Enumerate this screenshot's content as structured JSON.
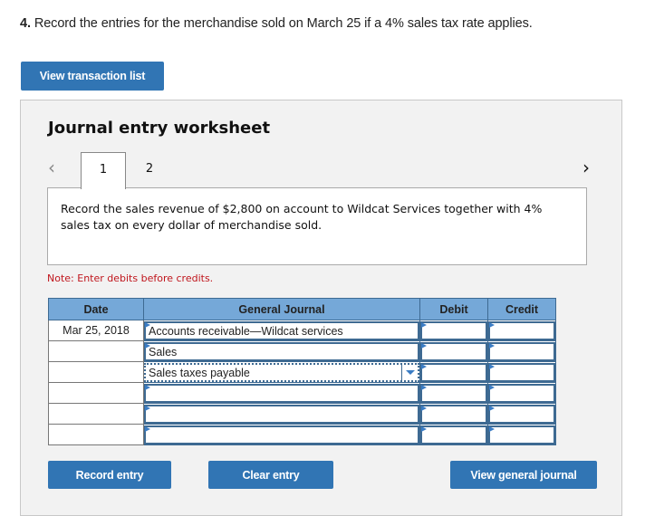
{
  "question": {
    "number": "4.",
    "text": " Record the entries for the merchandise sold on March 25 if a 4% sales tax rate applies."
  },
  "buttons": {
    "view_transaction_list": "View transaction list",
    "record_entry": "Record entry",
    "clear_entry": "Clear entry",
    "view_general_journal": "View general journal"
  },
  "worksheet": {
    "title": "Journal entry worksheet",
    "prev_icon": "‹",
    "next_icon": "›",
    "tabs": [
      {
        "label": "1",
        "active": true
      },
      {
        "label": "2",
        "active": false
      }
    ],
    "description": "Record the sales revenue of $2,800 on account to Wildcat Services together with 4% sales tax on every dollar of merchandise sold.",
    "note": "Note: Enter debits before credits."
  },
  "journal": {
    "headers": [
      "Date",
      "General Journal",
      "Debit",
      "Credit"
    ],
    "rows": [
      {
        "date": "Mar 25, 2018",
        "account": "Accounts receivable—Wildcat services",
        "debit": "",
        "credit": ""
      },
      {
        "date": "",
        "account": "Sales",
        "debit": "",
        "credit": ""
      },
      {
        "date": "",
        "account": "Sales taxes payable",
        "debit": "",
        "credit": ""
      },
      {
        "date": "",
        "account": "",
        "debit": "",
        "credit": ""
      },
      {
        "date": "",
        "account": "",
        "debit": "",
        "credit": ""
      },
      {
        "date": "",
        "account": "",
        "debit": "",
        "credit": ""
      }
    ]
  },
  "colors": {
    "button_blue": "#3175b4",
    "header_blue": "#75a8d8",
    "note_red": "#c0161d"
  }
}
